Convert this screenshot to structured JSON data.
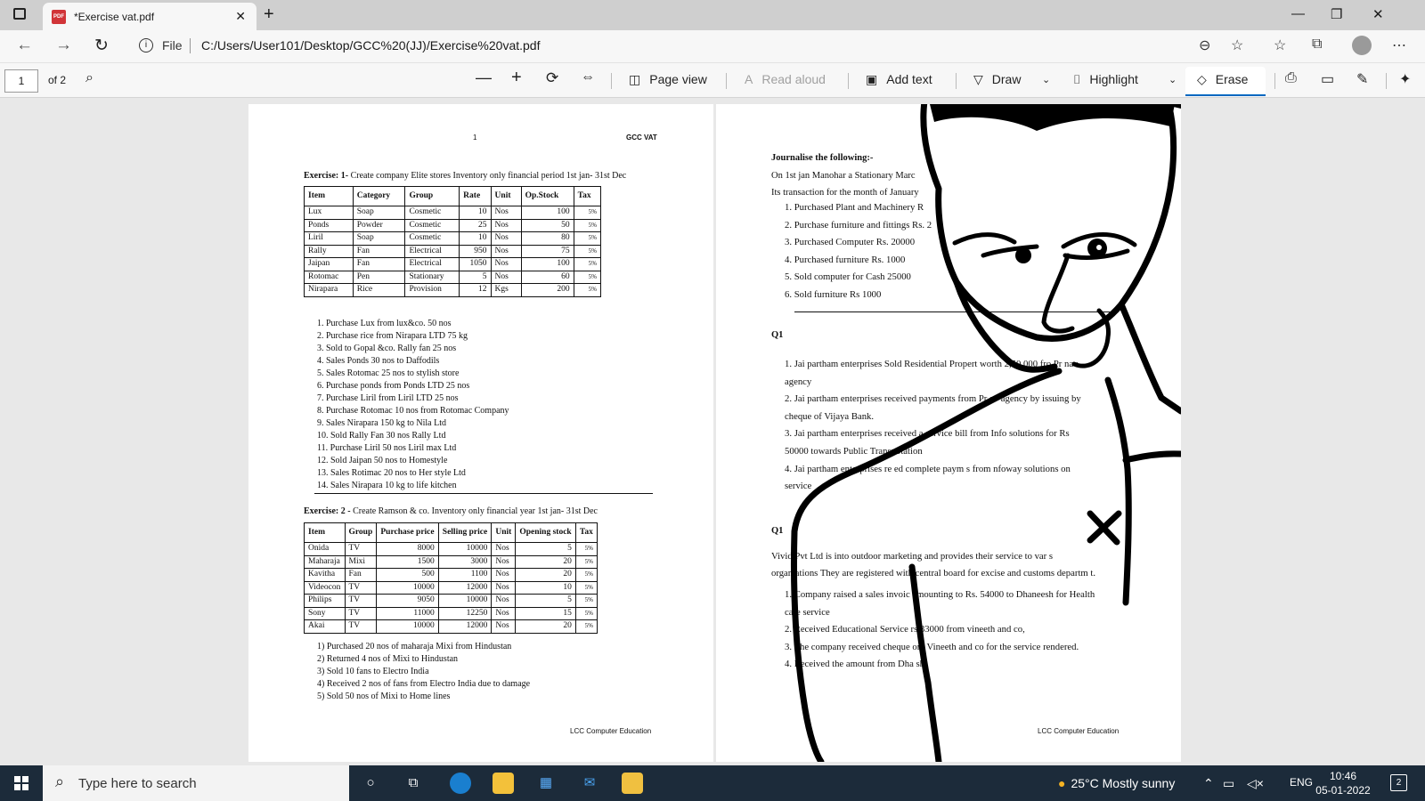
{
  "tab": {
    "title": "*Exercise vat.pdf",
    "icon": "pdf-icon"
  },
  "window": {
    "minimize": "—",
    "restore": "❐",
    "close": "✕"
  },
  "address": {
    "file_label": "File",
    "url": "C:/Users/User101/Desktop/GCC%20(JJ)/Exercise%20vat.pdf"
  },
  "pdf_toolbar": {
    "page_number": "1",
    "page_count": "of 2",
    "page_view": "Page view",
    "read_aloud": "Read aloud",
    "add_text": "Add text",
    "draw": "Draw",
    "highlight": "Highlight",
    "erase": "Erase"
  },
  "page1": {
    "page_num": "1",
    "header_right": "GCC VAT",
    "ex1_heading_bold": "Exercise: 1-",
    "ex1_heading_text": "Create company Elite stores Inventory only financial period 1st jan- 31st Dec",
    "table1_headers": [
      "Item",
      "Category",
      "Group",
      "Rate",
      "Unit",
      "Op.Stock",
      "Tax"
    ],
    "table1_rows": [
      [
        "Lux",
        "Soap",
        "Cosmetic",
        "10",
        "Nos",
        "100",
        "5%"
      ],
      [
        "Ponds",
        "Powder",
        "Cosmetic",
        "25",
        "Nos",
        "50",
        "5%"
      ],
      [
        "Liril",
        "Soap",
        "Cosmetic",
        "10",
        "Nos",
        "80",
        "5%"
      ],
      [
        "Rally",
        "Fan",
        "Electrical",
        "950",
        "Nos",
        "75",
        "5%"
      ],
      [
        "Jaipan",
        "Fan",
        "Electrical",
        "1050",
        "Nos",
        "100",
        "5%"
      ],
      [
        "Rotomac",
        "Pen",
        "Stationary",
        "5",
        "Nos",
        "60",
        "5%"
      ],
      [
        "Nirapara",
        "Rice",
        "Provision",
        "12",
        "Kgs",
        "200",
        "5%"
      ]
    ],
    "ex1_list": [
      "1.   Purchase Lux from lux&co.  50 nos",
      "2.   Purchase rice from Nirapara LTD 75 kg",
      "3.   Sold to Gopal &co. Rally fan 25 nos",
      "4.   Sales  Ponds 30 nos to Daffodils",
      "5.   Sales Rotomac 25 nos to stylish store",
      "6.   Purchase ponds from Ponds LTD 25 nos",
      "7.   Purchase Liril from Liril LTD 25 nos",
      "8.   Purchase Rotomac 10 nos  from Rotomac Company",
      "9.   Sales Nirapara 150 kg to Nila Ltd",
      "10. Sold Rally Fan 30 nos  Rally Ltd",
      "11. Purchase Liril 50 nos  Liril max Ltd",
      "12. Sold  Jaipan 50 nos  to Homestyle",
      "13. Sales Rotimac 20 nos to Her style Ltd",
      "14. Sales Nirapara 10 kg to life kitchen"
    ],
    "ex2_heading_bold": "Exercise: 2 -",
    "ex2_heading_text": "Create Ramson & co. Inventory only financial year 1st jan- 31st Dec",
    "table2_headers": [
      "Item",
      "Group",
      "Purchase price",
      "Selling price",
      "Unit",
      "Opening stock",
      "Tax"
    ],
    "table2_rows": [
      [
        "Onida",
        "TV",
        "8000",
        "10000",
        "Nos",
        "5",
        "5%"
      ],
      [
        "Maharaja",
        "Mixi",
        "1500",
        "3000",
        "Nos",
        "20",
        "5%"
      ],
      [
        "Kavitha",
        "Fan",
        "500",
        "1100",
        "Nos",
        "20",
        "5%"
      ],
      [
        "Videocon",
        "TV",
        "10000",
        "12000",
        "Nos",
        "10",
        "5%"
      ],
      [
        "Philips",
        "TV",
        "9050",
        "10000",
        "Nos",
        "5",
        "5%"
      ],
      [
        "Sony",
        "TV",
        "11000",
        "12250",
        "Nos",
        "15",
        "5%"
      ],
      [
        "Akai",
        "TV",
        "10000",
        "12000",
        "Nos",
        "20",
        "5%"
      ]
    ],
    "ex2_list": [
      "1)   Purchased 20 nos of maharaja Mixi from Hindustan",
      "2)   Returned 4 nos of Mixi to Hindustan",
      "3)   Sold 10 fans to Electro India",
      "4)   Received 2 nos of fans from Electro India due to damage",
      "5)   Sold 50 nos of Mixi to Home lines"
    ],
    "footer": "LCC Computer Education"
  },
  "page2": {
    "journal_heading": "Journalise the following:-",
    "intro1": "On 1st jan Manohar a Stationary Marc",
    "intro2": "Its transaction for the month of January",
    "journal_list": [
      "1.   Purchased Plant and Machinery R",
      "2.   Purchase furniture and fittings Rs. 2",
      "3.   Purchased Computer Rs. 20000",
      "4.   Purchased furniture Rs. 1000",
      "5.   Sold computer for Cash 25000",
      "6.   Sold furniture Rs 1000"
    ],
    "q1_a": "Q1",
    "q1a_list": [
      "1.   Jai partham enterprises Sold Residential Propert   worth 2,50,000 fro    Pr   nav",
      "      agency",
      "2.   Jai partham enterprises received payments from Pr   av agency by issuing by",
      "      cheque of Vijaya Bank.",
      "3.   Jai partham enterprises received  a service bill from Info    solutions for Rs",
      "      50000 towards Public Transpotation",
      "4.   Jai partham enterprises re    ed complete paym    s from   nfoway solutions on",
      "      service"
    ],
    "q1_b": "Q1",
    "vivid1": "Vivid  Pvt Ltd is into outdoor marketing and provides their service to  var    s",
    "vivid2": "organ   ations They are registered with central board for excise and customs departm   t.",
    "vivid_list": [
      "1.   Company raised a sales invoic    amounting to Rs. 54000 to Dhaneesh for Health",
      "      care service",
      "2.   Received Educational Service    rs 33000 from vineeth and co,",
      "3.   The company received cheque    om Vineeth and co for the service rendered.",
      "4.   Received the amount from Dha     sh"
    ],
    "footer": "LCC Computer Education"
  },
  "taskbar": {
    "search_placeholder": "Type here to search",
    "weather": "25°C  Mostly sunny",
    "language": "ENG",
    "time": "10:46",
    "date": "05-01-2022",
    "notifications": "2"
  }
}
